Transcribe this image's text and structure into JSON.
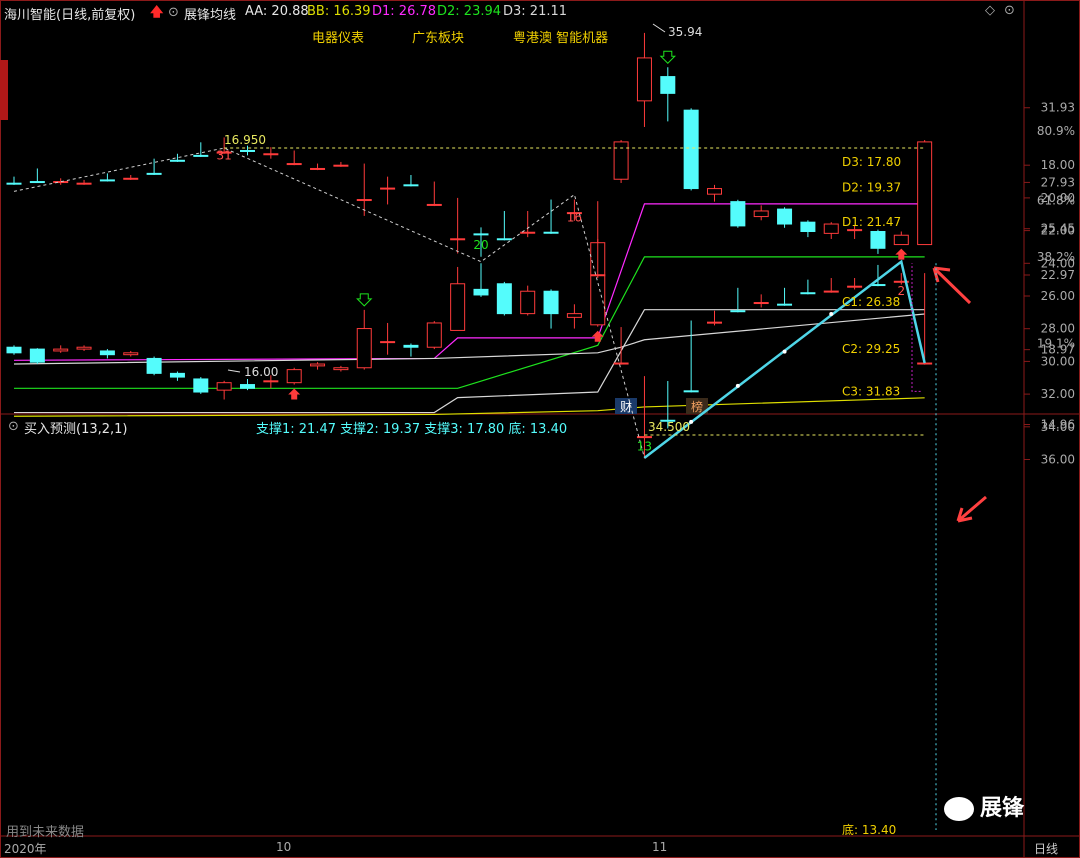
{
  "header": {
    "stock": "海川智能(日线,前复权)",
    "indicator": "展锋均线",
    "aa": "AA: 20.88",
    "bb": "BB: 16.39",
    "d1": "D1: 26.78",
    "d2": "D2: 23.94",
    "d3": "D3: 21.11",
    "tags": [
      "电器仪表",
      "广东板块",
      "粤港澳 智能机器"
    ]
  },
  "lower_header": {
    "name": "买入预测(13,2,1)",
    "support": "支撑1: 21.47  支撑2: 19.37  支撑3: 17.80  底: 13.40"
  },
  "footer": {
    "note": "用到未来数据",
    "year": "2020年",
    "m10": "10",
    "m11": "11",
    "period": "日线",
    "watermark": "展锋"
  },
  "colors": {
    "up": "#ff3b3b",
    "down": "#54fcfc",
    "magenta": "#ff2aff",
    "green": "#1ee21e",
    "white": "#d8d8d8",
    "yellow": "#dede00",
    "cyan_line": "#4fd6e8",
    "grid": "#8b1a1a"
  },
  "chart_data": [
    {
      "type": "candlestick",
      "title": "展锋均线",
      "y_ticks": [
        "31.93",
        "27.93",
        "25.45",
        "22.97",
        "18.97",
        "14.96"
      ],
      "pct_ticks": [
        "80.9%",
        "61.8%",
        "38.2%",
        "19.1%"
      ],
      "ylim": [
        14.96,
        35.94
      ],
      "annotations": [
        "35.94",
        "16.00",
        "财",
        "榜"
      ],
      "candles": [
        {
          "o": 19.1,
          "c": 18.8,
          "h": 19.2,
          "l": 18.7
        },
        {
          "o": 19.0,
          "c": 18.3,
          "h": 19.05,
          "l": 18.2
        },
        {
          "o": 18.9,
          "c": 19.0,
          "h": 19.2,
          "l": 18.8
        },
        {
          "o": 19.0,
          "c": 19.1,
          "h": 19.2,
          "l": 18.9
        },
        {
          "o": 18.9,
          "c": 18.7,
          "h": 19.0,
          "l": 18.5
        },
        {
          "o": 18.7,
          "c": 18.8,
          "h": 18.9,
          "l": 18.6
        },
        {
          "o": 18.5,
          "c": 17.7,
          "h": 18.6,
          "l": 17.6
        },
        {
          "o": 17.7,
          "c": 17.5,
          "h": 17.8,
          "l": 17.3
        },
        {
          "o": 17.4,
          "c": 16.7,
          "h": 17.5,
          "l": 16.6
        },
        {
          "o": 16.8,
          "c": 17.2,
          "h": 17.3,
          "l": 16.3
        },
        {
          "o": 17.1,
          "c": 16.9,
          "h": 17.4,
          "l": 16.8
        },
        {
          "o": 17.3,
          "c": 17.3,
          "h": 17.6,
          "l": 16.9
        },
        {
          "o": 17.2,
          "c": 17.9,
          "h": 18.0,
          "l": 17.1
        },
        {
          "o": 18.1,
          "c": 18.2,
          "h": 18.3,
          "l": 17.9
        },
        {
          "o": 17.9,
          "c": 18.0,
          "h": 18.1,
          "l": 17.8
        },
        {
          "o": 18.0,
          "c": 20.1,
          "h": 21.1,
          "l": 17.9
        },
        {
          "o": 19.4,
          "c": 19.4,
          "h": 20.4,
          "l": 18.7
        },
        {
          "o": 19.2,
          "c": 19.1,
          "h": 19.3,
          "l": 18.6
        },
        {
          "o": 19.1,
          "c": 20.4,
          "h": 20.5,
          "l": 19.0
        },
        {
          "o": 20.0,
          "c": 22.5,
          "h": 23.4,
          "l": 20.0
        },
        {
          "o": 22.2,
          "c": 21.9,
          "h": 23.6,
          "l": 21.8
        },
        {
          "o": 22.5,
          "c": 20.9,
          "h": 22.6,
          "l": 20.8
        },
        {
          "o": 20.9,
          "c": 22.1,
          "h": 22.4,
          "l": 20.8
        },
        {
          "o": 22.1,
          "c": 20.9,
          "h": 22.2,
          "l": 20.1
        },
        {
          "o": 20.7,
          "c": 20.9,
          "h": 21.4,
          "l": 20.1
        },
        {
          "o": 20.3,
          "c": 24.7,
          "h": 24.9,
          "l": 20.2
        },
        {
          "o": 28.1,
          "c": 30.1,
          "h": 30.2,
          "l": 27.9
        },
        {
          "o": 32.3,
          "c": 34.6,
          "h": 35.94,
          "l": 30.9
        },
        {
          "o": 33.6,
          "c": 32.7,
          "h": 34.1,
          "l": 31.2
        },
        {
          "o": 31.8,
          "c": 27.6,
          "h": 31.9,
          "l": 27.5
        },
        {
          "o": 27.3,
          "c": 27.6,
          "h": 27.8,
          "l": 26.9
        },
        {
          "o": 26.9,
          "c": 25.6,
          "h": 27.0,
          "l": 25.5
        },
        {
          "o": 26.1,
          "c": 26.4,
          "h": 26.7,
          "l": 25.9
        },
        {
          "o": 26.5,
          "c": 25.7,
          "h": 26.6,
          "l": 25.5
        },
        {
          "o": 25.8,
          "c": 25.3,
          "h": 25.9,
          "l": 25.0
        },
        {
          "o": 25.2,
          "c": 25.7,
          "h": 25.8,
          "l": 24.9
        },
        {
          "o": 25.4,
          "c": 25.4,
          "h": 25.6,
          "l": 24.9
        },
        {
          "o": 25.3,
          "c": 24.4,
          "h": 25.4,
          "l": 24.1
        },
        {
          "o": 24.6,
          "c": 25.1,
          "h": 25.3,
          "l": 24.6
        },
        {
          "o": 24.6,
          "c": 30.1,
          "h": 30.2,
          "l": 24.6
        }
      ],
      "series": [
        {
          "name": "D1",
          "color": "magenta",
          "points": [
            [
              0,
              18.4
            ],
            [
              18,
              18.5
            ],
            [
              19,
              19.6
            ],
            [
              25,
              19.6
            ],
            [
              27,
              26.78
            ],
            [
              39,
              26.78
            ]
          ]
        },
        {
          "name": "D2",
          "color": "green",
          "points": [
            [
              0,
              16.9
            ],
            [
              18,
              16.9
            ],
            [
              19,
              16.9
            ],
            [
              25,
              19.2
            ],
            [
              27,
              23.94
            ],
            [
              39,
              23.94
            ]
          ]
        },
        {
          "name": "D3",
          "color": "white",
          "points": [
            [
              0,
              15.6
            ],
            [
              18,
              15.6
            ],
            [
              19,
              16.4
            ],
            [
              25,
              16.7
            ],
            [
              27,
              21.11
            ],
            [
              39,
              21.11
            ]
          ]
        },
        {
          "name": "AA",
          "color": "white",
          "points": [
            [
              0,
              18.2
            ],
            [
              18,
              18.5
            ],
            [
              25,
              18.8
            ],
            [
              26,
              19.1
            ],
            [
              27,
              19.5
            ],
            [
              39,
              20.88
            ]
          ]
        },
        {
          "name": "BB",
          "color": "yellow",
          "points": [
            [
              0,
              15.4
            ],
            [
              18,
              15.5
            ],
            [
              25,
              15.7
            ],
            [
              27,
              15.9
            ],
            [
              39,
              16.39
            ]
          ]
        }
      ],
      "markers": [
        {
          "i": 15,
          "kind": "green-down"
        },
        {
          "i": 28,
          "kind": "green-down"
        },
        {
          "i": 12,
          "kind": "red-up"
        },
        {
          "i": 25,
          "kind": "red-up"
        },
        {
          "i": 38,
          "kind": "red-up"
        }
      ]
    },
    {
      "type": "candlestick",
      "title": "买入预测(13,2,1)",
      "y_ticks": [
        "36.00",
        "34.00",
        "32.00",
        "30.00",
        "28.00",
        "26.00",
        "24.00",
        "22.00",
        "20.00",
        "18.00"
      ],
      "ylim": [
        16.0,
        37.0
      ],
      "wave_labels": [
        {
          "text": "13",
          "i": 27
        },
        {
          "text": "20",
          "i": 20
        },
        {
          "text": "31",
          "i": 9
        },
        {
          "text": "16",
          "i": 24
        },
        {
          "text": "2",
          "i": 38
        }
      ],
      "levels": [
        {
          "text": "34.500",
          "value": 34.5
        },
        {
          "text": "16.950",
          "value": 16.95
        }
      ],
      "targets": [
        {
          "text": "C3: 31.83",
          "value": 31.83
        },
        {
          "text": "C2: 29.25",
          "value": 29.25
        },
        {
          "text": "C1: 26.38",
          "value": 26.38
        },
        {
          "text": "D1: 21.47",
          "value": 21.47
        },
        {
          "text": "D2: 19.37",
          "value": 19.37
        },
        {
          "text": "D3: 17.80",
          "value": 17.8
        },
        {
          "text": "底: 13.40",
          "value": 13.4
        }
      ]
    }
  ]
}
